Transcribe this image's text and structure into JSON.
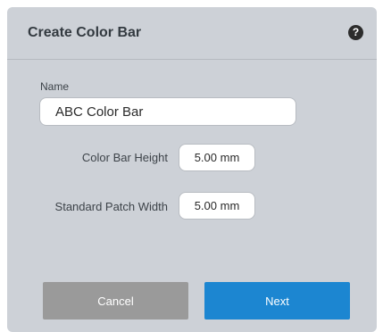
{
  "dialog": {
    "title": "Create Color Bar",
    "help_icon": "?"
  },
  "form": {
    "name_label": "Name",
    "name_value": "ABC Color Bar",
    "color_bar_height_label": "Color Bar Height",
    "color_bar_height_value": "5.00 mm",
    "standard_patch_width_label": "Standard Patch Width",
    "standard_patch_width_value": "5.00 mm"
  },
  "buttons": {
    "cancel_label": "Cancel",
    "next_label": "Next"
  },
  "colors": {
    "dialog_background": "#cdd1d7",
    "cancel_button": "#9a9a9a",
    "next_button": "#1c86d1"
  },
  "icons": {
    "help": "help-icon"
  }
}
